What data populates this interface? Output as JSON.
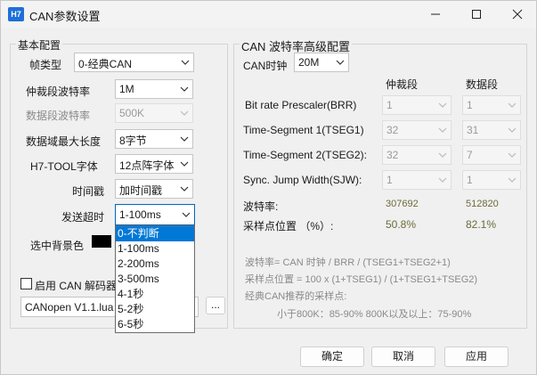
{
  "window": {
    "app_icon_text": "H7",
    "title": "CAN参数设置"
  },
  "basic": {
    "group_title": "基本配置",
    "frame_type_label": "帧类型",
    "frame_type_value": "0-经典CAN",
    "arb_baud_label": "仲裁段波特率",
    "arb_baud_value": "1M",
    "data_baud_label": "数据段波特率",
    "data_baud_value": "500K",
    "data_len_label": "数据域最大长度",
    "data_len_value": "8字节",
    "font_label": "H7-TOOL字体",
    "font_value": "12点阵字体",
    "timestamp_label": "时间戳",
    "timestamp_value": "加时间戳",
    "timeout_label": "发送超时",
    "timeout_value": "1-100ms",
    "bg_color_label": "选中背景色",
    "enable_decoder_label": "启用 CAN 解码器",
    "decoder_file": "CANopen V1.1.lua",
    "browse_label": "...",
    "timeout_options": [
      "0-不判断",
      "1-100ms",
      "2-200ms",
      "3-500ms",
      "4-1秒",
      "5-2秒",
      "6-5秒"
    ]
  },
  "advanced": {
    "group_title": "CAN 波特率高级配置",
    "can_clock_label": "CAN时钟",
    "can_clock_value": "20M",
    "col_arb": "仲裁段",
    "col_data": "数据段",
    "brr_label": "Bit rate  Prescaler(BRR)",
    "brr_arb": "1",
    "brr_data": "1",
    "tseg1_label": "Time-Segment 1(TSEG1)",
    "tseg1_arb": "32",
    "tseg1_data": "31",
    "tseg2_label": "Time-Segment 2(TSEG2):",
    "tseg2_arb": "32",
    "tseg2_data": "7",
    "sjw_label": "Sync. Jump Width(SJW):",
    "sjw_arb": "1",
    "sjw_data": "1",
    "baud_label": "波特率:",
    "baud_arb": "307692",
    "baud_data": "512820",
    "sample_label": "采样点位置 （%）:",
    "sample_arb": "50.8%",
    "sample_data": "82.1%",
    "formula_baud": "波特率= CAN 时钟 / BRR / (TSEG1+TSEG2+1)",
    "formula_sample": "采样点位置 = 100 x (1+TSEG1) / (1+TSEG1+TSEG2)",
    "recommend_title": "经典CAN推荐的采样点:",
    "recommend_values": "小于800K：85-90%    800K以及以上：75-90%"
  },
  "footer": {
    "ok_label": "确定",
    "cancel_label": "取消",
    "apply_label": "应用"
  }
}
